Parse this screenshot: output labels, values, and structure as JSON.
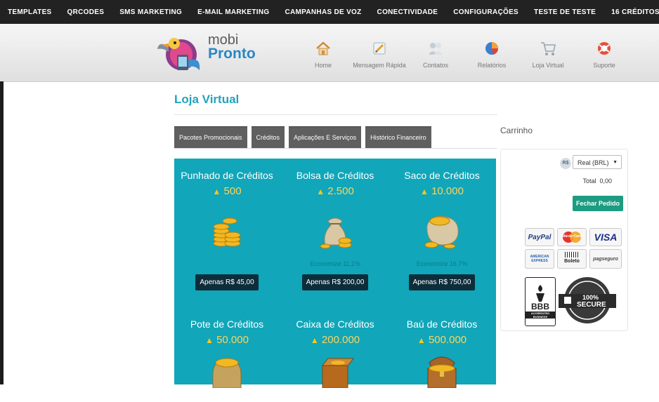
{
  "topnav": {
    "items": [
      "TEMPLATES",
      "QRCODES",
      "SMS MARKETING",
      "E-MAIL MARKETING",
      "CAMPANHAS DE VOZ",
      "CONECTIVIDADE",
      "CONFIGURAÇÕES"
    ],
    "user": "TESTE DE TESTE",
    "credits": "16 CRÉDITOS"
  },
  "logo": {
    "line1": "mobi",
    "line2": "Pronto"
  },
  "nav": [
    {
      "label": "Home",
      "icon": "home-icon"
    },
    {
      "label": "Mensagem Rápida",
      "icon": "quick-message-icon"
    },
    {
      "label": "Contatos",
      "icon": "contacts-icon"
    },
    {
      "label": "Relatórios",
      "icon": "reports-icon"
    },
    {
      "label": "Loja Virtual",
      "icon": "cart-icon"
    },
    {
      "label": "Suporte",
      "icon": "support-icon"
    }
  ],
  "page": {
    "title": "Loja Virtual"
  },
  "tabs": [
    "Pacotes Promocionais",
    "Créditos",
    "Aplicações E Serviços",
    "Histórico Financeiro"
  ],
  "products": [
    {
      "name": "Punhado de Créditos",
      "qty": "500",
      "economy": "",
      "price": "Apenas R$ 45,00"
    },
    {
      "name": "Bolsa de Créditos",
      "qty": "2.500",
      "economy": "Economize 11,1%",
      "price": "Apenas R$ 200,00"
    },
    {
      "name": "Saco de Créditos",
      "qty": "10.000",
      "economy": "Economize 16,7%",
      "price": "Apenas R$ 750,00"
    },
    {
      "name": "Pote de Créditos",
      "qty": "50.000"
    },
    {
      "name": "Caixa de Créditos",
      "qty": "200.000"
    },
    {
      "name": "Baú de Créditos",
      "qty": "500.000"
    }
  ],
  "cart": {
    "title": "Carrinho",
    "currency_symbol": "R$",
    "currency": "Real (BRL)",
    "total_label": "Total",
    "total_value": "0,00",
    "checkout": "Fechar Pedido",
    "payments": {
      "paypal": "PayPal",
      "mastercard": "MasterCard",
      "visa": "VISA",
      "amex": "AMERICAN EXPRESS",
      "boleto": "Boleto",
      "pagseguro": "pagseguro",
      "bbb": "BBB",
      "bbb_sub": "ACCREDITED BUSINESS",
      "secure_pct": "100%",
      "secure": "SECURE"
    }
  },
  "colors": {
    "accent": "#22a3bf",
    "panel": "#11a6b9",
    "checkout": "#1c9c80",
    "navbar": "#222222"
  }
}
